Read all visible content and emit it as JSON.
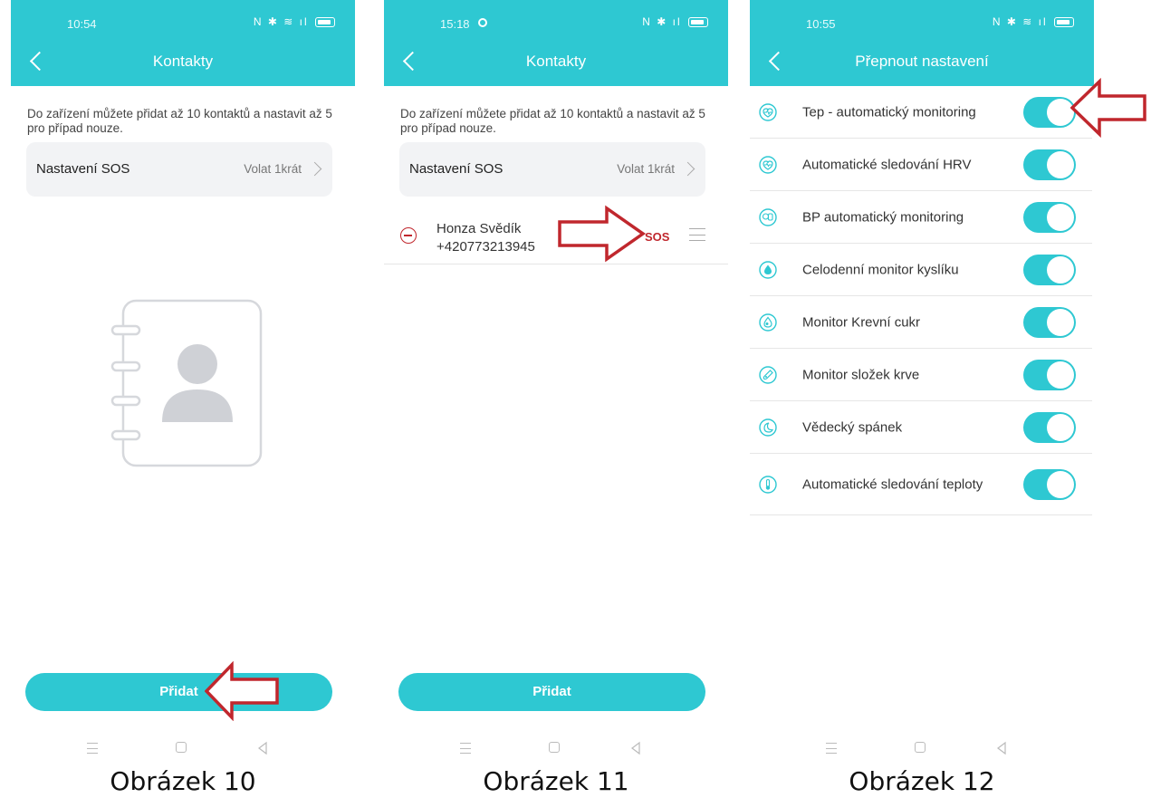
{
  "screens": [
    {
      "status_time": "10:54",
      "title": "Kontakty",
      "info_text": "Do zařízení můžete přidat až 10 kontaktů a nastavit až 5 pro případ nouze.",
      "sos_label": "Nastavení SOS",
      "sos_value": "Volat 1krát",
      "add_button": "Přidat",
      "caption": "Obrázek 10"
    },
    {
      "status_time": "15:18",
      "title": "Kontakty",
      "info_text": "Do zařízení můžete přidat až 10 kontaktů a nastavit až 5 pro případ nouze.",
      "sos_label": "Nastavení SOS",
      "sos_value": "Volat 1krát",
      "contact": {
        "name": "Honza Svědík",
        "phone": "+420773213945",
        "sos_tag": "SOS"
      },
      "add_button": "Přidat",
      "caption": "Obrázek 11"
    },
    {
      "status_time": "10:55",
      "title": "Přepnout nastavení",
      "settings": [
        {
          "label": "Tep - automatický monitoring",
          "icon": "heart-rate-icon",
          "enabled": true
        },
        {
          "label": "Automatické sledování HRV",
          "icon": "hrv-icon",
          "enabled": true
        },
        {
          "label": "BP automatický monitoring",
          "icon": "blood-pressure-icon",
          "enabled": true
        },
        {
          "label": "Celodenní monitor kyslíku",
          "icon": "oxygen-drop-icon",
          "enabled": true
        },
        {
          "label": "Monitor Krevní cukr",
          "icon": "blood-sugar-icon",
          "enabled": true
        },
        {
          "label": "Monitor složek krve",
          "icon": "blood-components-icon",
          "enabled": true
        },
        {
          "label": "Vědecký spánek",
          "icon": "sleep-moon-icon",
          "enabled": true
        },
        {
          "label": "Automatické sledování teploty",
          "icon": "thermometer-icon",
          "enabled": true
        }
      ],
      "caption": "Obrázek 12"
    }
  ],
  "colors": {
    "accent": "#2ec8d2",
    "annotation_arrow": "#c0272d",
    "sos_text": "#c0272d"
  }
}
